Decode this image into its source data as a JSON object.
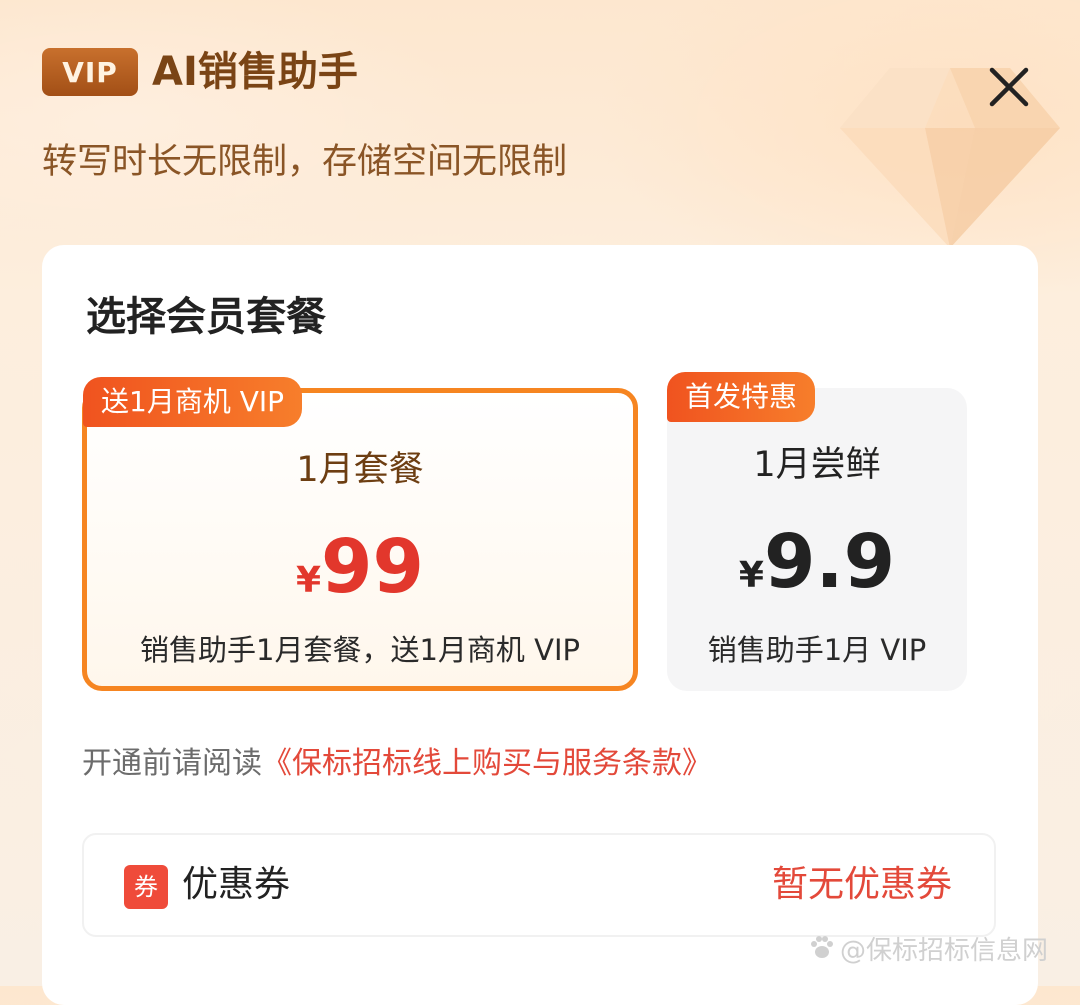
{
  "header": {
    "badge": "VIP",
    "title": "AI销售助手",
    "subtitle": "转写时长无限制，存储空间无限制"
  },
  "card": {
    "section_title": "选择会员套餐",
    "plans": [
      {
        "tag": "送1月商机 VIP",
        "name": "1月套餐",
        "currency": "¥",
        "price": "99",
        "description": "销售助手1月套餐，送1月商机 VIP",
        "selected": true
      },
      {
        "tag": "首发特惠",
        "name": "1月尝鲜",
        "currency": "¥",
        "price": "9.9",
        "description": "销售助手1月 VIP",
        "selected": false
      }
    ],
    "terms_prefix": "开通前请阅读",
    "terms_link": "《保标招标线上购买与服务条款》",
    "coupon": {
      "icon_text": "券",
      "label": "优惠券",
      "status": "暂无优惠券"
    }
  },
  "watermark": "@保标招标信息网",
  "colors": {
    "accent_orange": "#f68521",
    "price_red": "#e2372c",
    "link_red": "#e3493a",
    "badge_brown": "#a24f16"
  },
  "icons": {
    "close": "close-icon",
    "gem": "diamond-icon",
    "watermark": "paw-icon"
  }
}
